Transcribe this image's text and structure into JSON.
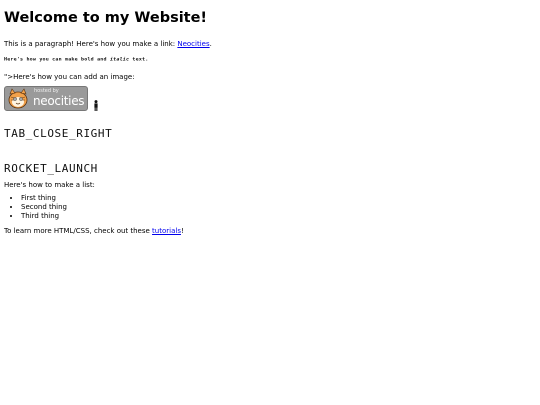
{
  "heading": "Welcome to my Website!",
  "intro": {
    "text": "This is a paragraph! Here's how you make a link: ",
    "link_label": "Neocities",
    "suffix": "."
  },
  "formatting_line": {
    "prefix": "Here's how you can make ",
    "bold_word": "bold",
    "middle": " and ",
    "italic_word": "italic",
    "suffix": " text."
  },
  "image_intro": "\">Here's how you can add an image:",
  "badge": {
    "small_text": "hosted by",
    "brand_text": "neocities",
    "background_color": "#9a9a9a"
  },
  "icons": {
    "first": "TAB_CLOSE_RIGHT",
    "second": "ROCKET_LAUNCH"
  },
  "list_intro": "Here's how to make a list:",
  "list_items": [
    "First thing",
    "Second thing",
    "Third thing"
  ],
  "outro": {
    "text": "To learn more HTML/CSS, check out these ",
    "link_label": "tutorials",
    "suffix": "!"
  },
  "colors": {
    "link": "#0000ee",
    "text": "#000000",
    "background": "#ffffff"
  }
}
